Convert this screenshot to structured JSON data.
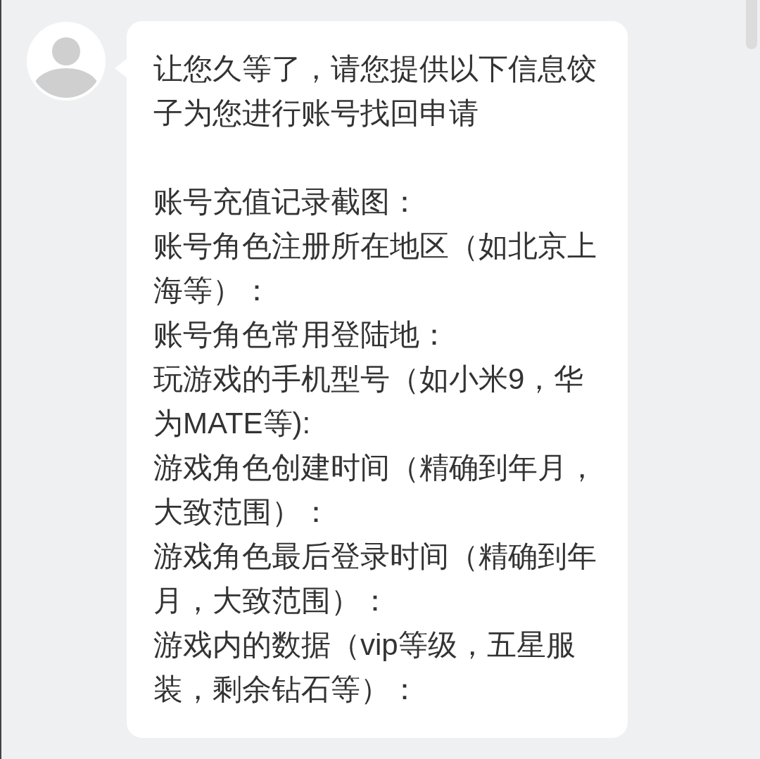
{
  "message": {
    "intro": "让您久等了，请您提供以下信息饺子为您进行账号找回申请",
    "fields": [
      "账号充值记录截图：",
      "账号角色注册所在地区（如北京上海等）：",
      "账号角色常用登陆地：",
      "玩游戏的手机型号（如小米9，华为MATE等):",
      "游戏角色创建时间（精确到年月，大致范围）：",
      "游戏角色最后登录时间（精确到年月，大致范围）：",
      "游戏内的数据（vip等级，五星服装，剩余钻石等）："
    ]
  }
}
